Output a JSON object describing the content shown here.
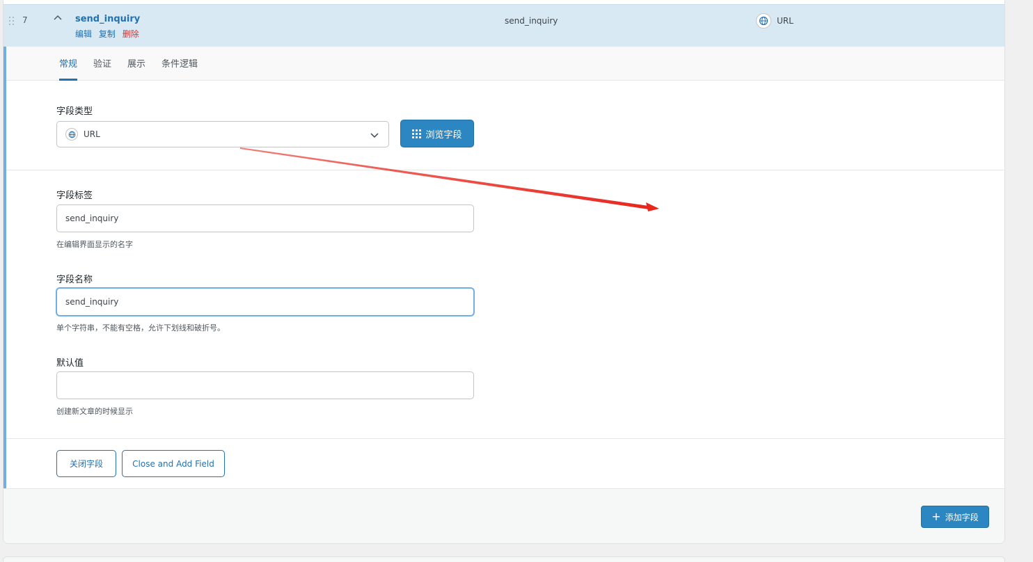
{
  "row": {
    "number": "7",
    "title": "send_inquiry",
    "actions": {
      "edit": "编辑",
      "duplicate": "复制",
      "delete": "删除"
    },
    "name_col": "send_inquiry",
    "type_col": "URL",
    "type_icon": "globe-icon"
  },
  "tabs": [
    {
      "label": "常规",
      "active": true
    },
    {
      "label": "验证",
      "active": false
    },
    {
      "label": "展示",
      "active": false
    },
    {
      "label": "条件逻辑",
      "active": false
    }
  ],
  "field_type": {
    "label": "字段类型",
    "selected": "URL",
    "browse_label": "浏览字段"
  },
  "field_label": {
    "label": "字段标签",
    "value": "send_inquiry",
    "help": "在编辑界面显示的名字"
  },
  "field_name": {
    "label": "字段名称",
    "value": "send_inquiry",
    "help": "单个字符串，不能有空格，允许下划线和破折号。"
  },
  "default_value": {
    "label": "默认值",
    "value": "",
    "help": "创建新文章的时候显示"
  },
  "buttons": {
    "close_field": "关闭字段",
    "close_and_add": "Close and Add Field",
    "add_field": "添加字段"
  },
  "colors": {
    "accent": "#2271b1",
    "primary_button": "#2c86c1",
    "header_bg": "#d8e9f3",
    "danger": "#d63638",
    "annotation_arrow": "#e8261c"
  }
}
